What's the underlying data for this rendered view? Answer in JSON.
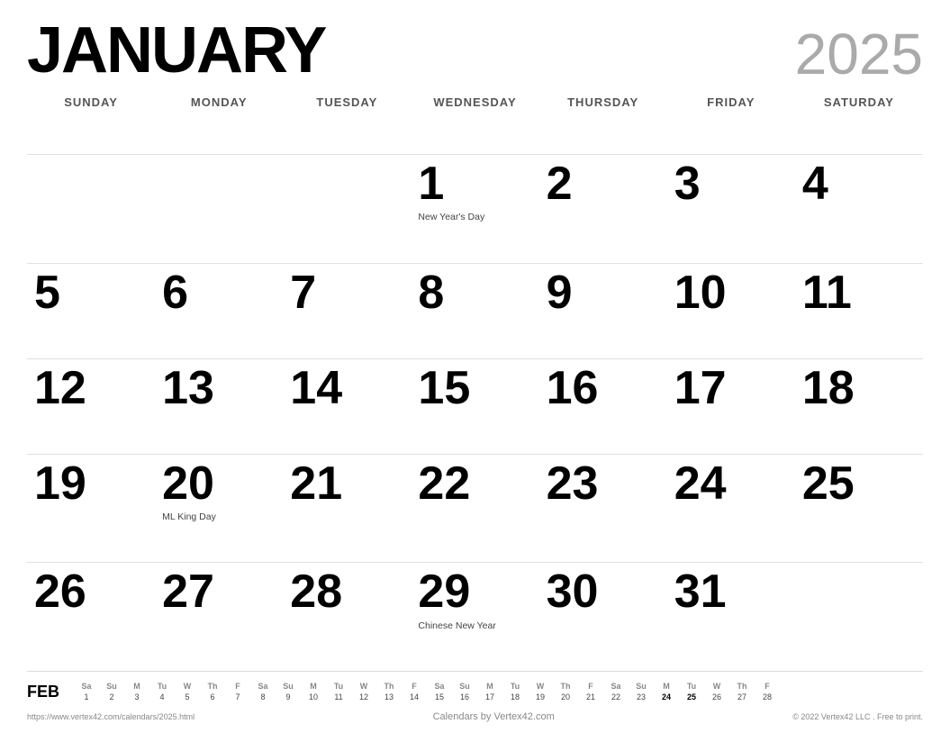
{
  "header": {
    "month": "JANUARY",
    "year": "2025"
  },
  "day_headers": [
    "SUNDAY",
    "MONDAY",
    "TUESDAY",
    "WEDNESDAY",
    "THURSDAY",
    "FRIDAY",
    "SATURDAY"
  ],
  "weeks": [
    [
      {
        "num": "",
        "empty": true
      },
      {
        "num": "",
        "empty": true
      },
      {
        "num": "",
        "empty": true
      },
      {
        "num": "1",
        "holiday": "New Year's Day"
      },
      {
        "num": "2",
        "holiday": ""
      },
      {
        "num": "3",
        "holiday": ""
      },
      {
        "num": "4",
        "holiday": ""
      }
    ],
    [
      {
        "num": "5",
        "holiday": ""
      },
      {
        "num": "6",
        "holiday": ""
      },
      {
        "num": "7",
        "holiday": ""
      },
      {
        "num": "8",
        "holiday": ""
      },
      {
        "num": "9",
        "holiday": ""
      },
      {
        "num": "10",
        "holiday": ""
      },
      {
        "num": "11",
        "holiday": ""
      }
    ],
    [
      {
        "num": "12",
        "holiday": ""
      },
      {
        "num": "13",
        "holiday": ""
      },
      {
        "num": "14",
        "holiday": ""
      },
      {
        "num": "15",
        "holiday": ""
      },
      {
        "num": "16",
        "holiday": ""
      },
      {
        "num": "17",
        "holiday": ""
      },
      {
        "num": "18",
        "holiday": ""
      }
    ],
    [
      {
        "num": "19",
        "holiday": ""
      },
      {
        "num": "20",
        "holiday": "ML King Day"
      },
      {
        "num": "21",
        "holiday": ""
      },
      {
        "num": "22",
        "holiday": ""
      },
      {
        "num": "23",
        "holiday": ""
      },
      {
        "num": "24",
        "holiday": ""
      },
      {
        "num": "25",
        "holiday": ""
      }
    ],
    [
      {
        "num": "26",
        "holiday": ""
      },
      {
        "num": "27",
        "holiday": ""
      },
      {
        "num": "28",
        "holiday": ""
      },
      {
        "num": "29",
        "holiday": "Chinese New Year"
      },
      {
        "num": "30",
        "holiday": ""
      },
      {
        "num": "31",
        "holiday": ""
      },
      {
        "num": "",
        "empty": true
      }
    ]
  ],
  "mini_cal": {
    "label": "FEB",
    "headers": [
      "Sa",
      "Su",
      "M",
      "Tu",
      "W",
      "Th",
      "F",
      "Sa",
      "Su",
      "M",
      "Tu",
      "W",
      "Th",
      "F",
      "Sa",
      "Su",
      "M",
      "Tu",
      "W",
      "Th",
      "F",
      "Sa",
      "Su",
      "M",
      "Tu",
      "W",
      "Th",
      "F"
    ],
    "days": [
      "1",
      "2",
      "3",
      "4",
      "5",
      "6",
      "7",
      "8",
      "9",
      "10",
      "11",
      "12",
      "13",
      "14",
      "15",
      "16",
      "17",
      "18",
      "19",
      "20",
      "21",
      "22",
      "23",
      "24",
      "25",
      "26",
      "27",
      "28"
    ],
    "bold_days": [
      "24",
      "25"
    ]
  },
  "footer": {
    "left": "https://www.vertex42.com/calendars/2025.html",
    "center": "Calendars by Vertex42.com",
    "right": "© 2022 Vertex42 LLC . Free to print."
  }
}
